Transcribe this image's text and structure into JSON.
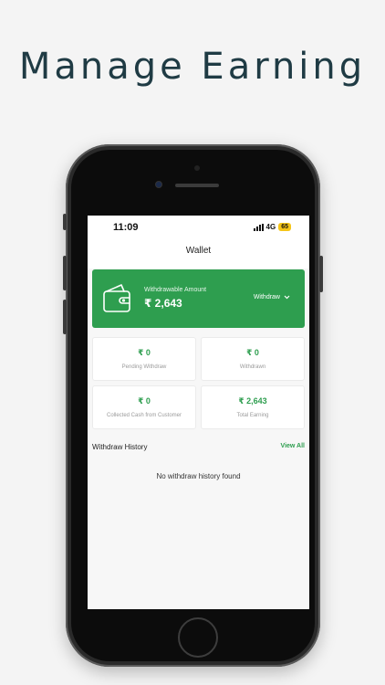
{
  "headline": "Manage Earning",
  "status_bar": {
    "time": "11:09",
    "network": "4G",
    "battery": "65"
  },
  "app_bar": {
    "title": "Wallet"
  },
  "balance_card": {
    "label": "Withdrawable Amount",
    "amount": "₹ 2,643",
    "withdraw_label": "Withdraw",
    "wallet_icon": "wallet-icon",
    "chevron_icon": "chevron-down-icon"
  },
  "stats": [
    {
      "value": "₹ 0",
      "label": "Pending Withdraw"
    },
    {
      "value": "₹ 0",
      "label": "Withdrawn"
    },
    {
      "value": "₹ 0",
      "label": "Collected Cash from Customer"
    },
    {
      "value": "₹ 2,643",
      "label": "Total Earning"
    }
  ],
  "withdraw_history": {
    "title": "Withdraw History",
    "view_all": "View All",
    "empty_message": "No withdraw history found"
  },
  "colors": {
    "accent": "#2e9e4f",
    "headline": "#1f3b44",
    "background": "#f4f4f4"
  }
}
